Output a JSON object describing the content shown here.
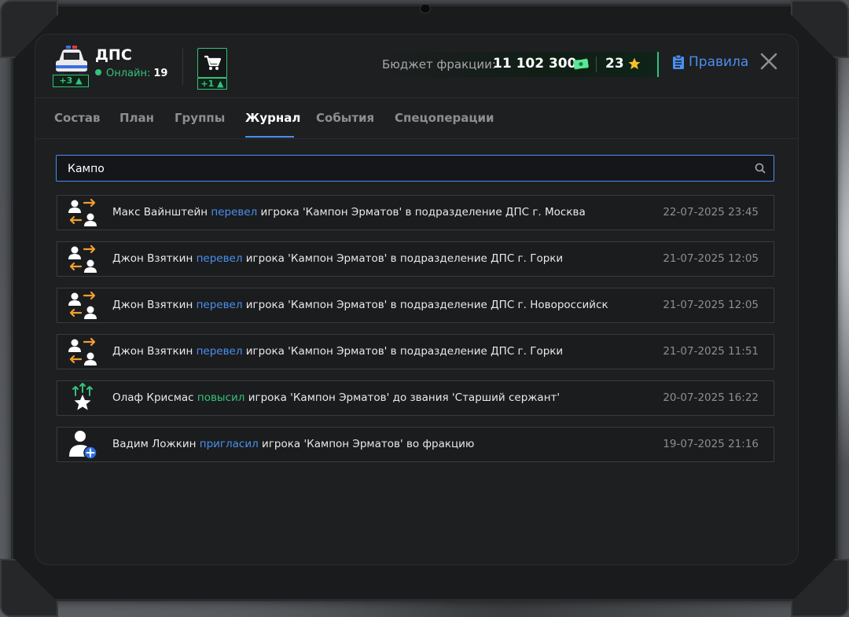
{
  "header": {
    "faction_name": "ДПС",
    "faction_badge": "+3",
    "online_label": "Онлайн:",
    "online_count": "19",
    "cart_badge": "+1",
    "budget_label": "Бюджет фракции:",
    "budget_value": "11 102 300",
    "stars_value": "23",
    "rules_label": "Правила"
  },
  "tabs": [
    {
      "label": "Состав",
      "active": false
    },
    {
      "label": "План",
      "active": false
    },
    {
      "label": "Группы",
      "active": false
    },
    {
      "label": "Журнал",
      "active": true
    },
    {
      "label": "События",
      "active": false
    },
    {
      "label": "Спецоперации",
      "active": false
    }
  ],
  "search": {
    "value": "Кампо",
    "placeholder": ""
  },
  "log": [
    {
      "icon": "transfer-icon",
      "actor": "Макс Вайнштейн",
      "verb": "перевел",
      "verb_color": "blue",
      "rest": "игрока 'Кампон Эрматов' в подразделение ДПС г. Москва",
      "date": "22-07-2025 23:45"
    },
    {
      "icon": "transfer-icon",
      "actor": "Джон Взяткин",
      "verb": "перевел",
      "verb_color": "blue",
      "rest": "игрока 'Кампон Эрматов' в подразделение ДПС г. Горки",
      "date": "21-07-2025 12:05"
    },
    {
      "icon": "transfer-icon",
      "actor": "Джон Взяткин",
      "verb": "перевел",
      "verb_color": "blue",
      "rest": "игрока 'Кампон Эрматов' в подразделение ДПС г. Новороссийск",
      "date": "21-07-2025 12:05"
    },
    {
      "icon": "transfer-icon",
      "actor": "Джон Взяткин",
      "verb": "перевел",
      "verb_color": "blue",
      "rest": "игрока 'Кампон Эрматов' в подразделение ДПС г. Горки",
      "date": "21-07-2025 11:51"
    },
    {
      "icon": "promote-icon",
      "actor": "Олаф Крисмас",
      "verb": "повысил",
      "verb_color": "green",
      "rest": "игрока 'Кампон Эрматов' до звания 'Старший сержант'",
      "date": "20-07-2025 16:22"
    },
    {
      "icon": "invite-icon",
      "actor": "Вадим Ложкин",
      "verb": "пригласил",
      "verb_color": "blue",
      "rest": "игрока 'Кампон Эрматов' во фракцию",
      "date": "19-07-2025 21:16"
    }
  ],
  "colors": {
    "accent": "#4a8ff0",
    "green": "#34c27a",
    "orange": "#f0a030"
  }
}
